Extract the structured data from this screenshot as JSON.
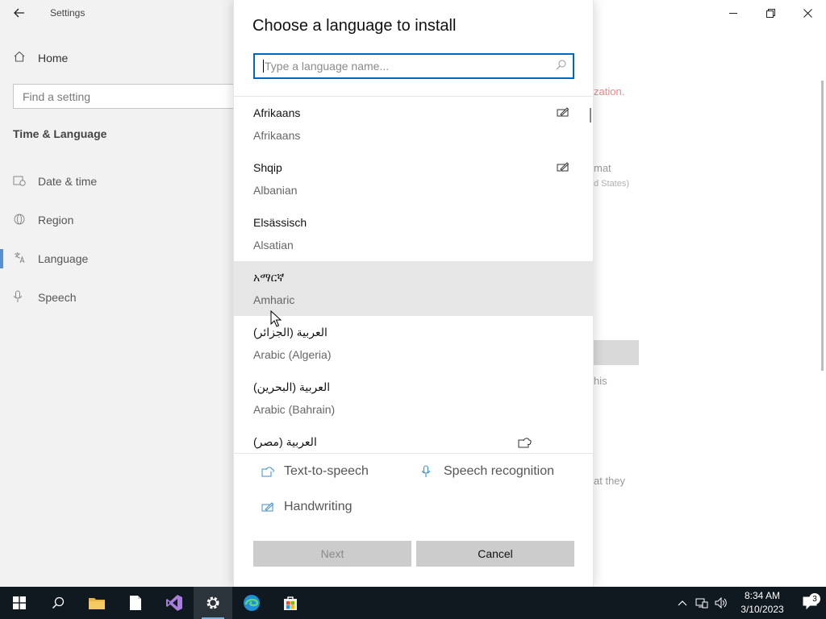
{
  "settings": {
    "window_title": "Settings",
    "home_label": "Home",
    "search_placeholder": "Find a setting",
    "section_title": "Time & Language",
    "nav_items": [
      {
        "label": "Date & time"
      },
      {
        "label": "Region"
      },
      {
        "label": "Language"
      },
      {
        "label": "Speech"
      }
    ],
    "background_fragments": {
      "error_text": "zation.",
      "format_text": "mat",
      "region_text": "d States)",
      "this_text": "his",
      "they_text": "at they"
    }
  },
  "dialog": {
    "title": "Choose a language to install",
    "search_placeholder": "Type a language name...",
    "languages": [
      {
        "native": "Afrikaans",
        "english": "Afrikaans",
        "feature_icon": "handwriting-icon"
      },
      {
        "native": "Shqip",
        "english": "Albanian",
        "feature_icon": "handwriting-icon"
      },
      {
        "native": "Elsässisch",
        "english": "Alsatian",
        "feature_icon": ""
      },
      {
        "native": "አማርኛ",
        "english": "Amharic",
        "feature_icon": "",
        "hovered": true
      },
      {
        "native": "العربية (الجزائر)",
        "english": "Arabic (Algeria)",
        "feature_icon": ""
      },
      {
        "native": "العربية (البحرين)",
        "english": "Arabic (Bahrain)",
        "feature_icon": ""
      },
      {
        "native": "العربية (مصر)",
        "english": "",
        "feature_icon": "text-to-speech-icon"
      }
    ],
    "features": {
      "tts": "Text-to-speech",
      "speech": "Speech recognition",
      "handwriting": "Handwriting"
    },
    "buttons": {
      "next": "Next",
      "cancel": "Cancel"
    }
  },
  "taskbar": {
    "time": "8:34 AM",
    "date": "3/10/2023",
    "notification_count": "3"
  },
  "colors": {
    "accent": "#0067c0",
    "hover_row": "#e6e6e6",
    "taskbar": "#101820",
    "button": "#cccccc"
  }
}
